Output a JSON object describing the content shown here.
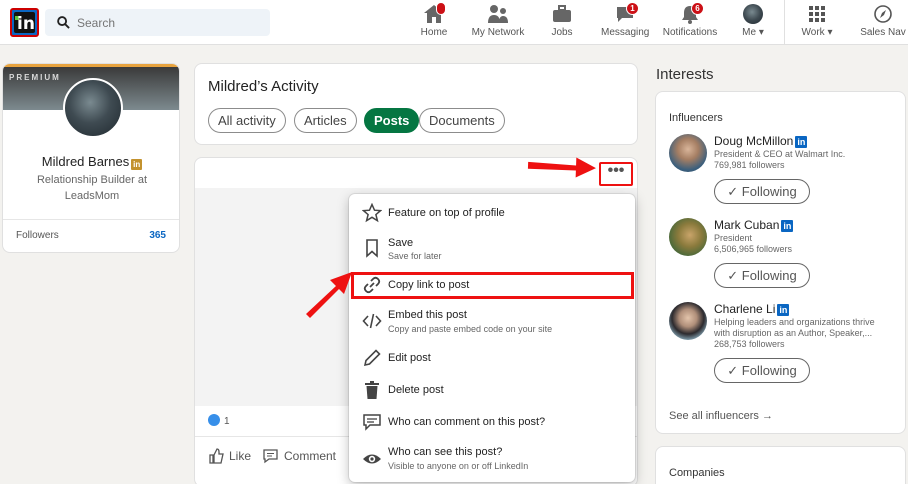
{
  "nav": {
    "search_placeholder": "Search",
    "items": [
      {
        "label": "Home",
        "icon": "home-icon",
        "badge": ""
      },
      {
        "label": "My Network",
        "icon": "network-icon",
        "badge": ""
      },
      {
        "label": "Jobs",
        "icon": "briefcase-icon",
        "badge": ""
      },
      {
        "label": "Messaging",
        "icon": "messaging-icon",
        "badge": "1"
      },
      {
        "label": "Notifications",
        "icon": "bell-icon",
        "badge": "6"
      },
      {
        "label": "Me",
        "icon": "avatar-icon",
        "badge": ""
      },
      {
        "label": "Work",
        "icon": "grid-icon",
        "badge": ""
      },
      {
        "label": "Sales Nav",
        "icon": "compass-icon",
        "badge": ""
      }
    ]
  },
  "profile": {
    "banner_label": "PREMIUM",
    "name": "Mildred Barnes",
    "headline": "Relationship Builder at LeadsMom",
    "followers_label": "Followers",
    "followers_count": "365"
  },
  "activity": {
    "title": "Mildred’s Activity",
    "filters": [
      "All activity",
      "Articles",
      "Posts",
      "Documents"
    ],
    "active_filter": "Posts"
  },
  "post": {
    "more_label": "•••",
    "reaction_count": "1",
    "like_label": "Like",
    "comment_label": "Comment"
  },
  "menu": {
    "items": [
      {
        "label": "Feature on top of profile",
        "sub": "",
        "icon": "star-icon"
      },
      {
        "label": "Save",
        "sub": "Save for later",
        "icon": "bookmark-icon"
      },
      {
        "label": "Copy link to post",
        "sub": "",
        "icon": "link-icon"
      },
      {
        "label": "Embed this post",
        "sub": "Copy and paste embed code on your site",
        "icon": "code-icon"
      },
      {
        "label": "Edit post",
        "sub": "",
        "icon": "pencil-icon"
      },
      {
        "label": "Delete post",
        "sub": "",
        "icon": "trash-icon"
      },
      {
        "label": "Who can comment on this post?",
        "sub": "",
        "icon": "comment-icon"
      },
      {
        "label": "Who can see this post?",
        "sub": "Visible to anyone on or off LinkedIn",
        "icon": "eye-icon"
      }
    ]
  },
  "interests": {
    "title": "Interests",
    "influencers_heading": "Influencers",
    "influencers": [
      {
        "name": "Doug McMillon",
        "line1": "President & CEO at Walmart Inc.",
        "line2": "769,981 followers",
        "button": "Following"
      },
      {
        "name": "Mark Cuban",
        "line1": "President",
        "line2": "6,506,965 followers",
        "button": "Following"
      },
      {
        "name": "Charlene Li",
        "line1": "Helping leaders and organizations thrive",
        "line2": "with disruption as an Author, Speaker,...",
        "line3": "268,753 followers",
        "button": "Following"
      }
    ],
    "see_all": "See all influencers →",
    "companies_heading": "Companies"
  },
  "colors": {
    "accent": "#0a66c2",
    "active_pill": "#057642",
    "annotation_red": "#e11111",
    "badge_red": "#cc1016",
    "premium_gold": "#c3922e"
  }
}
